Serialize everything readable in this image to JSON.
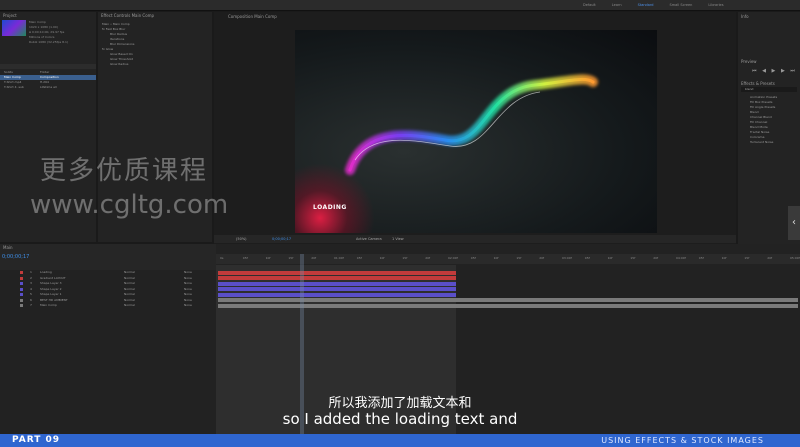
{
  "workspaces": [
    "Default",
    "Learn",
    "Standard",
    "Small Screen",
    "Libraries"
  ],
  "active_workspace": "Standard",
  "project_panel": {
    "tab": "Project",
    "meta": [
      "Main Comp",
      "1920 x 1080 (1.00)",
      "Δ 0;00;10;00, 29.97 fps",
      "Millions of Colors",
      "Rubik 1080 (32.25fps 8.1)"
    ],
    "items": [
      {
        "name": "Solids",
        "type": "Folder",
        "selected": false
      },
      {
        "name": "Main Comp",
        "type": "Composition",
        "selected": true
      },
      {
        "name": "T-Shirt.mp4",
        "type": "H.264",
        "selected": false
      },
      {
        "name": "T-Shirt 4 .sub",
        "type": "Lifetime all",
        "selected": false
      }
    ]
  },
  "effect_controls": {
    "tab": "Effect Controls Main Comp",
    "rows": [
      "Main • Main Comp",
      "fx  Fast Box Blur",
      "Blur Radius",
      "Iterations",
      "Blur Dimensions",
      "fx  Glow",
      "Glow Based On",
      "Glow Threshold",
      "Glow Radius"
    ]
  },
  "composition": {
    "tab": "Composition Main Comp",
    "loading_label": "LOADING",
    "zoom": "(50%)",
    "timecode": "0;00;00;17",
    "view": "Active Camera",
    "views": "1 View"
  },
  "right_panels": {
    "info_tab": "Info",
    "preview_tab": "Preview",
    "effects_tab": "Effects & Presets",
    "search_placeholder": "blend",
    "items": [
      "Animation Presets",
      "Fill Box Presets",
      "Fill Angle Presets",
      "Blend",
      "Channel Blend",
      "Fill Channel",
      "Blend Mode",
      "Fractal Noise",
      "Colorama",
      "Turbulent Noise"
    ]
  },
  "timeline": {
    "tab": "Main",
    "timecode": "0;00;00;17",
    "layers": [
      {
        "num": "1",
        "name": "Loading",
        "mode": "Normal",
        "parent": "None",
        "color": "#c23b3b"
      },
      {
        "num": "2",
        "name": "Gradient LAYOUT",
        "mode": "Normal",
        "parent": "None",
        "color": "#c23b3b"
      },
      {
        "num": "3",
        "name": "Shape Layer 3",
        "mode": "Normal",
        "parent": "None",
        "color": "#5a4fc9"
      },
      {
        "num": "4",
        "name": "Shape Layer 2",
        "mode": "Normal",
        "parent": "None",
        "color": "#5a4fc9"
      },
      {
        "num": "5",
        "name": "Shape Layer 1",
        "mode": "Normal",
        "parent": "None",
        "color": "#5a4fc9"
      },
      {
        "num": "6",
        "name": "BEST HD AMBIENT",
        "mode": "Normal",
        "parent": "None",
        "color": "#7a7a7a"
      },
      {
        "num": "7",
        "name": "Main Comp",
        "mode": "Normal",
        "parent": "None",
        "color": "#7a7a7a"
      }
    ],
    "ruler": [
      "0s",
      "05f",
      "10f",
      "15f",
      "20f",
      "01:00f",
      "05f",
      "10f",
      "15f",
      "20f",
      "02:00f",
      "05f",
      "10f",
      "15f",
      "20f",
      "03:00f",
      "05f",
      "10f",
      "15f",
      "20f",
      "04:00f",
      "05f",
      "10f",
      "15f",
      "20f",
      "05:00f"
    ]
  },
  "subtitles": {
    "cn": "所以我添加了加载文本和",
    "en": "so I added the loading text and"
  },
  "banner": {
    "part": "PART 09",
    "section": "USING EFFECTS & STOCK IMAGES"
  },
  "watermark": {
    "cn": "更多优质课程",
    "url": "www.cgltg.com"
  }
}
